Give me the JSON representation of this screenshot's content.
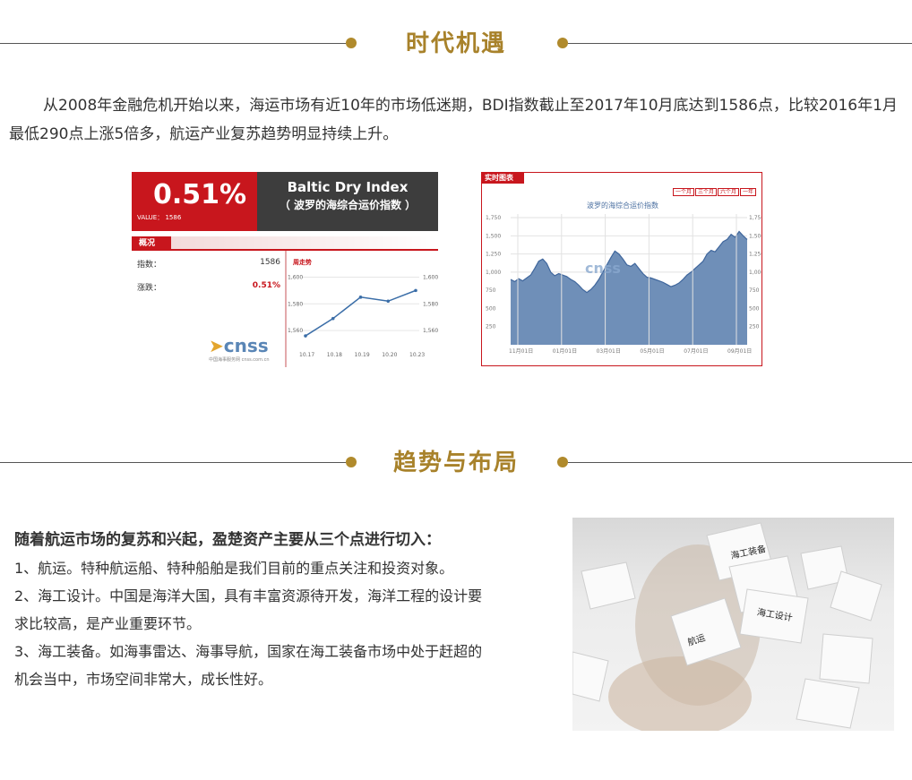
{
  "sections": {
    "s1_title": "时代机遇",
    "s2_title": "趋势与布局"
  },
  "intro": {
    "text": "从2008年金融危机开始以来，海运市场有近10年的市场低迷期，BDI指数截止至2017年10月底达到1586点，比较2016年1月最低290点上涨5倍多，航运产业复苏趋势明显持续上升。"
  },
  "card1": {
    "percent": "0.51%",
    "value_label": "VALUE： 1586",
    "index_en": "Baltic Dry Index",
    "index_cn": "（ 波罗的海综合运价指数 ）",
    "tab": "概况",
    "rows": [
      {
        "label": "指数：",
        "value": "1586"
      },
      {
        "label": "涨跌：",
        "value": "0.51%"
      }
    ],
    "chart_label": "周走势",
    "logo_text": "cnss",
    "logo_sub": "中国海事服务网  cnss.com.cn",
    "value_color": "#c8161d"
  },
  "chart_data": [
    {
      "type": "line",
      "title": "周走势",
      "categories": [
        "10.17",
        "10.18",
        "10.19",
        "10.20",
        "10.23"
      ],
      "values": [
        1556,
        1569,
        1585,
        1582,
        1590
      ],
      "ylim": [
        1550,
        1605
      ],
      "yticks": [
        "1,600",
        "1,580",
        "1,560"
      ],
      "yticks_right": [
        "1,600",
        "1,580",
        "1,560"
      ],
      "color": "#3b6ea8",
      "grid": true
    },
    {
      "type": "area",
      "title": "波罗的海综合运价指数",
      "tag": "实时图表",
      "controls": [
        "一个月",
        "三个月",
        "六个月",
        "一年"
      ],
      "x_ticks": [
        "11月01日",
        "01月01日",
        "03月01日",
        "05月01日",
        "07月01日",
        "09月01日"
      ],
      "yticks": [
        "1,750",
        "1,500",
        "1,250",
        "1,000",
        "750",
        "500",
        "250"
      ],
      "yticks_right": [
        "1,750",
        "1,500",
        "1,250",
        "1,000",
        "750",
        "500",
        "250"
      ],
      "ylim": [
        0,
        1800
      ],
      "values": [
        900,
        870,
        910,
        880,
        920,
        960,
        1050,
        1150,
        1180,
        1120,
        1000,
        950,
        980,
        960,
        940,
        900,
        870,
        820,
        760,
        720,
        760,
        820,
        900,
        1000,
        1100,
        1200,
        1290,
        1250,
        1180,
        1100,
        1080,
        1120,
        1050,
        980,
        930,
        920,
        900,
        880,
        860,
        830,
        800,
        820,
        850,
        900,
        960,
        1000,
        1050,
        1100,
        1150,
        1250,
        1300,
        1280,
        1350,
        1420,
        1450,
        1520,
        1480,
        1560,
        1500,
        1450
      ],
      "fill": "#6f8fb8",
      "line": "#3f669c",
      "grid": true
    }
  ],
  "lower": {
    "lead": "随着航运市场的复苏和兴起，盈楚资产主要从三个点进行切入：",
    "item1": "1、航运。特种航运船、特种船舶是我们目前的重点关注和投资对象。",
    "item2a": "2、海工设计。中国是海洋大国，具有丰富资源待开发，海洋工程的设计要",
    "item2b": "求比较高，是产业重要环节。",
    "item3a": "3、海工装备。如海事雷达、海事导航，国家在海工装备市场中处于赶超的",
    "item3b": "机会当中，市场空间非常大，成长性好。"
  },
  "photo": {
    "label1": "海工装备",
    "label2": "海工设计",
    "label3": "航运"
  }
}
